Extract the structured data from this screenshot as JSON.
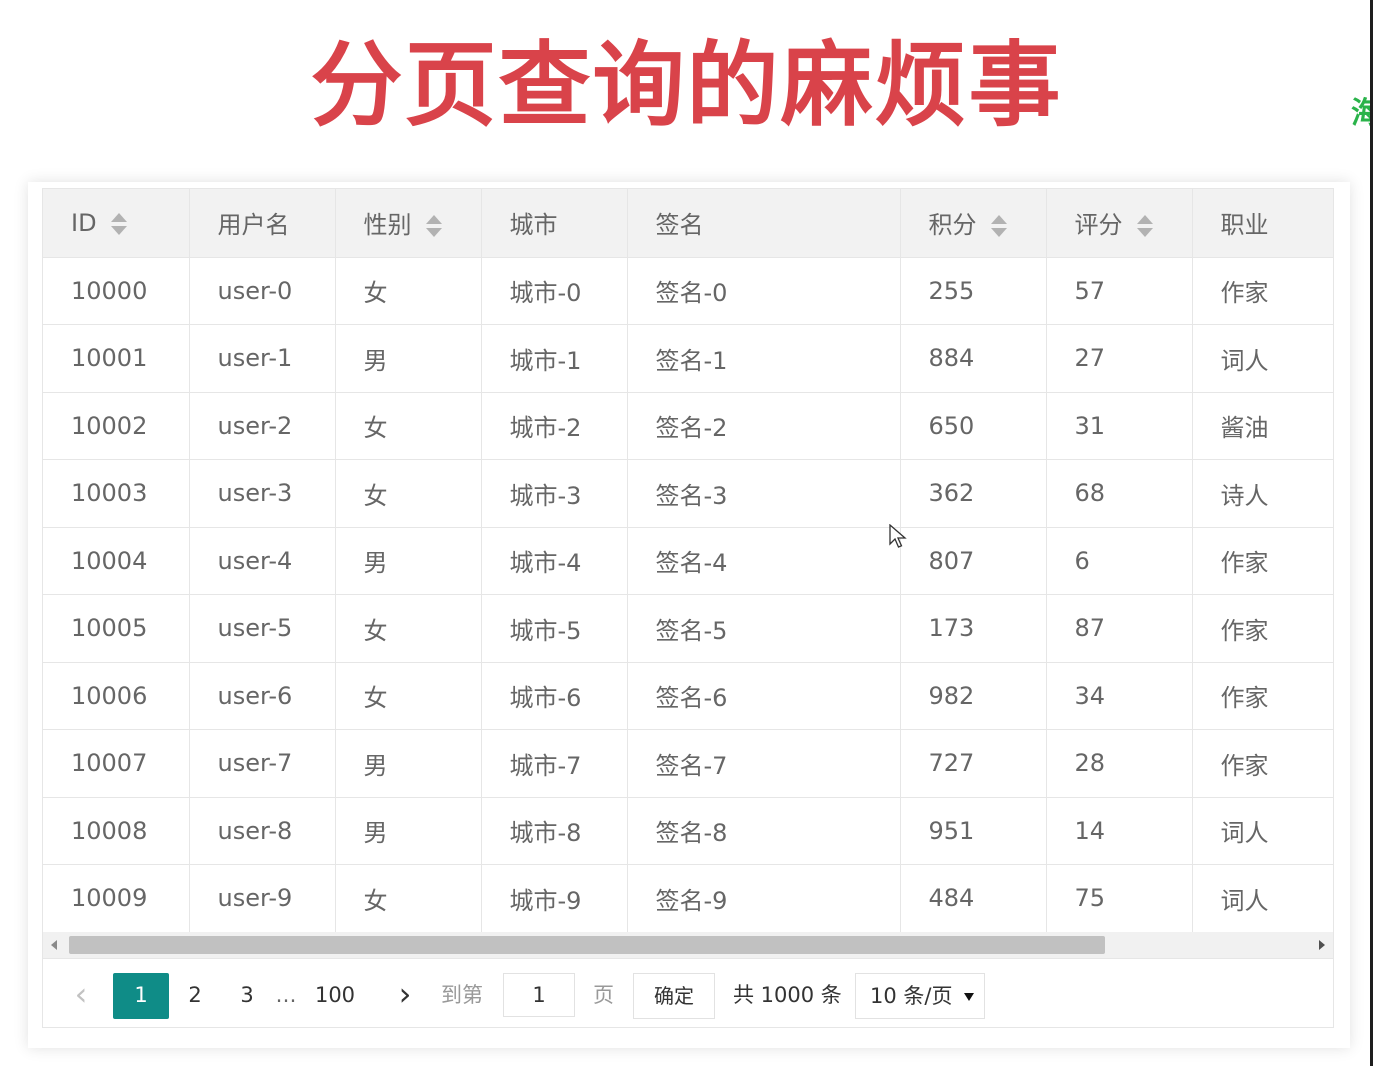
{
  "title": "分页查询的麻烦事",
  "side_text": "海",
  "table": {
    "columns": [
      {
        "label": "ID",
        "sortable": true
      },
      {
        "label": "用户名",
        "sortable": false
      },
      {
        "label": "性别",
        "sortable": true
      },
      {
        "label": "城市",
        "sortable": false
      },
      {
        "label": "签名",
        "sortable": false
      },
      {
        "label": "积分",
        "sortable": true
      },
      {
        "label": "评分",
        "sortable": true
      },
      {
        "label": "职业",
        "sortable": false
      }
    ],
    "rows": [
      [
        "10000",
        "user-0",
        "女",
        "城市-0",
        "签名-0",
        "255",
        "57",
        "作家"
      ],
      [
        "10001",
        "user-1",
        "男",
        "城市-1",
        "签名-1",
        "884",
        "27",
        "词人"
      ],
      [
        "10002",
        "user-2",
        "女",
        "城市-2",
        "签名-2",
        "650",
        "31",
        "酱油"
      ],
      [
        "10003",
        "user-3",
        "女",
        "城市-3",
        "签名-3",
        "362",
        "68",
        "诗人"
      ],
      [
        "10004",
        "user-4",
        "男",
        "城市-4",
        "签名-4",
        "807",
        "6",
        "作家"
      ],
      [
        "10005",
        "user-5",
        "女",
        "城市-5",
        "签名-5",
        "173",
        "87",
        "作家"
      ],
      [
        "10006",
        "user-6",
        "女",
        "城市-6",
        "签名-6",
        "982",
        "34",
        "作家"
      ],
      [
        "10007",
        "user-7",
        "男",
        "城市-7",
        "签名-7",
        "727",
        "28",
        "作家"
      ],
      [
        "10008",
        "user-8",
        "男",
        "城市-8",
        "签名-8",
        "951",
        "14",
        "词人"
      ],
      [
        "10009",
        "user-9",
        "女",
        "城市-9",
        "签名-9",
        "484",
        "75",
        "词人"
      ]
    ]
  },
  "pagination": {
    "prev": "‹",
    "current": "1",
    "page2": "2",
    "page3": "3",
    "ellipsis": "…",
    "last": "100",
    "next": "›",
    "goto_label": "到第",
    "goto_value": "1",
    "page_label": "页",
    "confirm": "确定",
    "total": "共 1000 条",
    "page_size": "10 条/页"
  },
  "colors": {
    "title": "#d9434a",
    "accent": "#0f8c87",
    "side_text": "#2ab34a"
  }
}
